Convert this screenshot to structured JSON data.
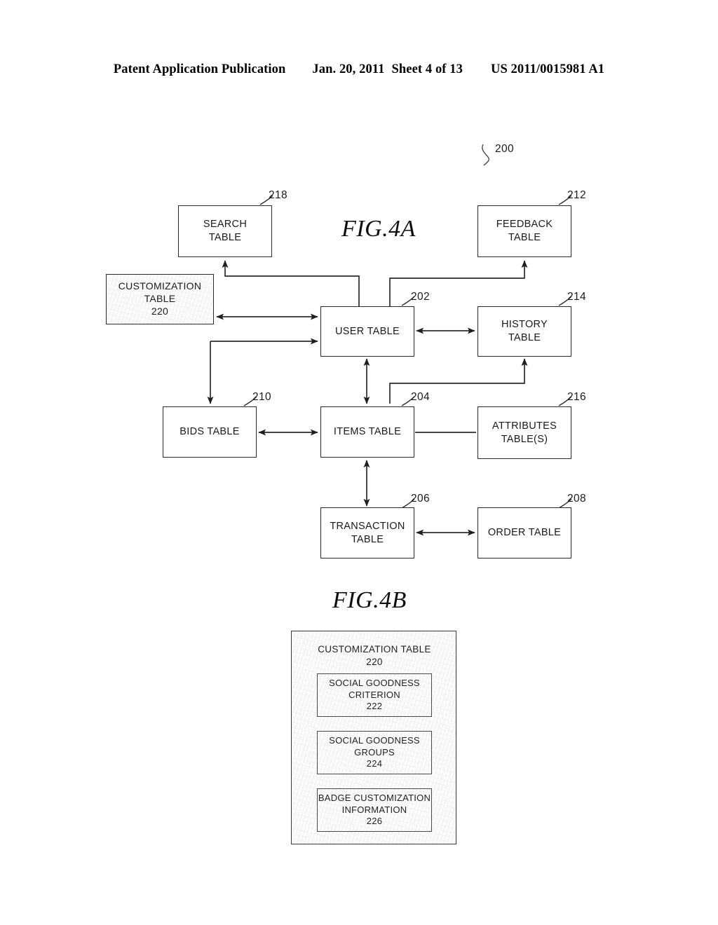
{
  "header": {
    "publication": "Patent Application Publication",
    "date": "Jan. 20, 2011",
    "sheet": "Sheet 4 of 13",
    "patent_number": "US 2011/0015981 A1"
  },
  "figures": {
    "fig4a": {
      "caption": "FIG.4A",
      "system_ref": "200",
      "nodes": [
        {
          "id": "search",
          "ref": "218",
          "line1": "SEARCH",
          "line2": "TABLE",
          "line3": ""
        },
        {
          "id": "feedback",
          "ref": "212",
          "line1": "FEEDBACK",
          "line2": "TABLE",
          "line3": ""
        },
        {
          "id": "customization",
          "ref": "",
          "line1": "CUSTOMIZATION",
          "line2": "TABLE",
          "line3": "220"
        },
        {
          "id": "user",
          "ref": "202",
          "line1": "USER TABLE",
          "line2": "",
          "line3": ""
        },
        {
          "id": "history",
          "ref": "214",
          "line1": "HISTORY",
          "line2": "TABLE",
          "line3": ""
        },
        {
          "id": "bids",
          "ref": "210",
          "line1": "BIDS TABLE",
          "line2": "",
          "line3": ""
        },
        {
          "id": "items",
          "ref": "204",
          "line1": "ITEMS TABLE",
          "line2": "",
          "line3": ""
        },
        {
          "id": "attributes",
          "ref": "216",
          "line1": "ATTRIBUTES",
          "line2": "TABLE(S)",
          "line3": ""
        },
        {
          "id": "transaction",
          "ref": "206",
          "line1": "TRANSACTION",
          "line2": "TABLE",
          "line3": ""
        },
        {
          "id": "order",
          "ref": "208",
          "line1": "ORDER TABLE",
          "line2": "",
          "line3": ""
        }
      ]
    },
    "fig4b": {
      "caption": "FIG.4B",
      "container": {
        "title": "CUSTOMIZATION TABLE",
        "ref": "220"
      },
      "items": [
        {
          "id": "criterion",
          "line1": "SOCIAL GOODNESS",
          "line2": "CRITERION",
          "ref": "222"
        },
        {
          "id": "groups",
          "line1": "SOCIAL GOODNESS",
          "line2": "GROUPS",
          "ref": "224"
        },
        {
          "id": "badge",
          "line1": "BADGE CUSTOMIZATION",
          "line2": "INFORMATION",
          "ref": "226"
        }
      ]
    }
  },
  "colors": {
    "ink": "#1a1a1a",
    "line": "#2b2b2b",
    "paper": "#ffffff"
  }
}
